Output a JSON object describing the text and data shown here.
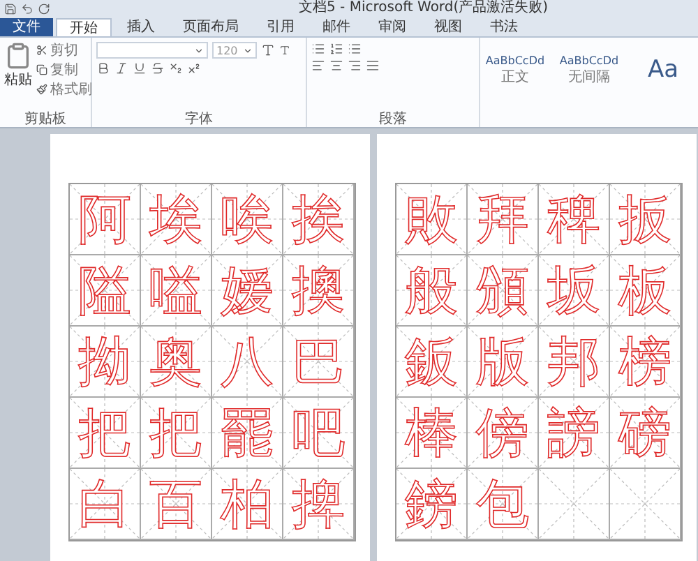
{
  "window": {
    "title": "文档5 - Microsoft Word(产品激活失败)"
  },
  "tabs": [
    {
      "label": "文件",
      "kind": "file",
      "selected": false
    },
    {
      "label": "开始",
      "kind": "tab",
      "selected": true
    },
    {
      "label": "插入",
      "kind": "tab",
      "selected": false
    },
    {
      "label": "页面布局",
      "kind": "tab",
      "selected": false
    },
    {
      "label": "引用",
      "kind": "tab",
      "selected": false
    },
    {
      "label": "邮件",
      "kind": "tab",
      "selected": false
    },
    {
      "label": "审阅",
      "kind": "tab",
      "selected": false
    },
    {
      "label": "视图",
      "kind": "tab",
      "selected": false
    },
    {
      "label": "书法",
      "kind": "tab",
      "selected": false
    }
  ],
  "clipboard": {
    "title": "剪贴板",
    "paste": "粘贴",
    "items": [
      "剪切",
      "复制",
      "格式刷"
    ]
  },
  "font": {
    "title": "字体",
    "size": "120"
  },
  "paragraph": {
    "title": "段落"
  },
  "styles": [
    {
      "preview": "AaBbCcDd",
      "name": "正文"
    },
    {
      "preview": "AaBbCcDd",
      "name": "无间隔"
    },
    {
      "preview": "Aa"
    }
  ],
  "pages": [
    {
      "cells": [
        "阿",
        "埃",
        "唉",
        "挨",
        "隘",
        "嗌",
        "嫒",
        "擙",
        "拗",
        "奥",
        "八",
        "巴",
        "把",
        "把",
        "罷",
        "吧",
        "白",
        "百",
        "柏",
        "捭"
      ]
    },
    {
      "cells": [
        "敗",
        "拜",
        "稗",
        "扳",
        "般",
        "頒",
        "坂",
        "板",
        "鈑",
        "版",
        "邦",
        "榜",
        "棒",
        "傍",
        "謗",
        "磅",
        "鎊",
        "包"
      ]
    }
  ]
}
